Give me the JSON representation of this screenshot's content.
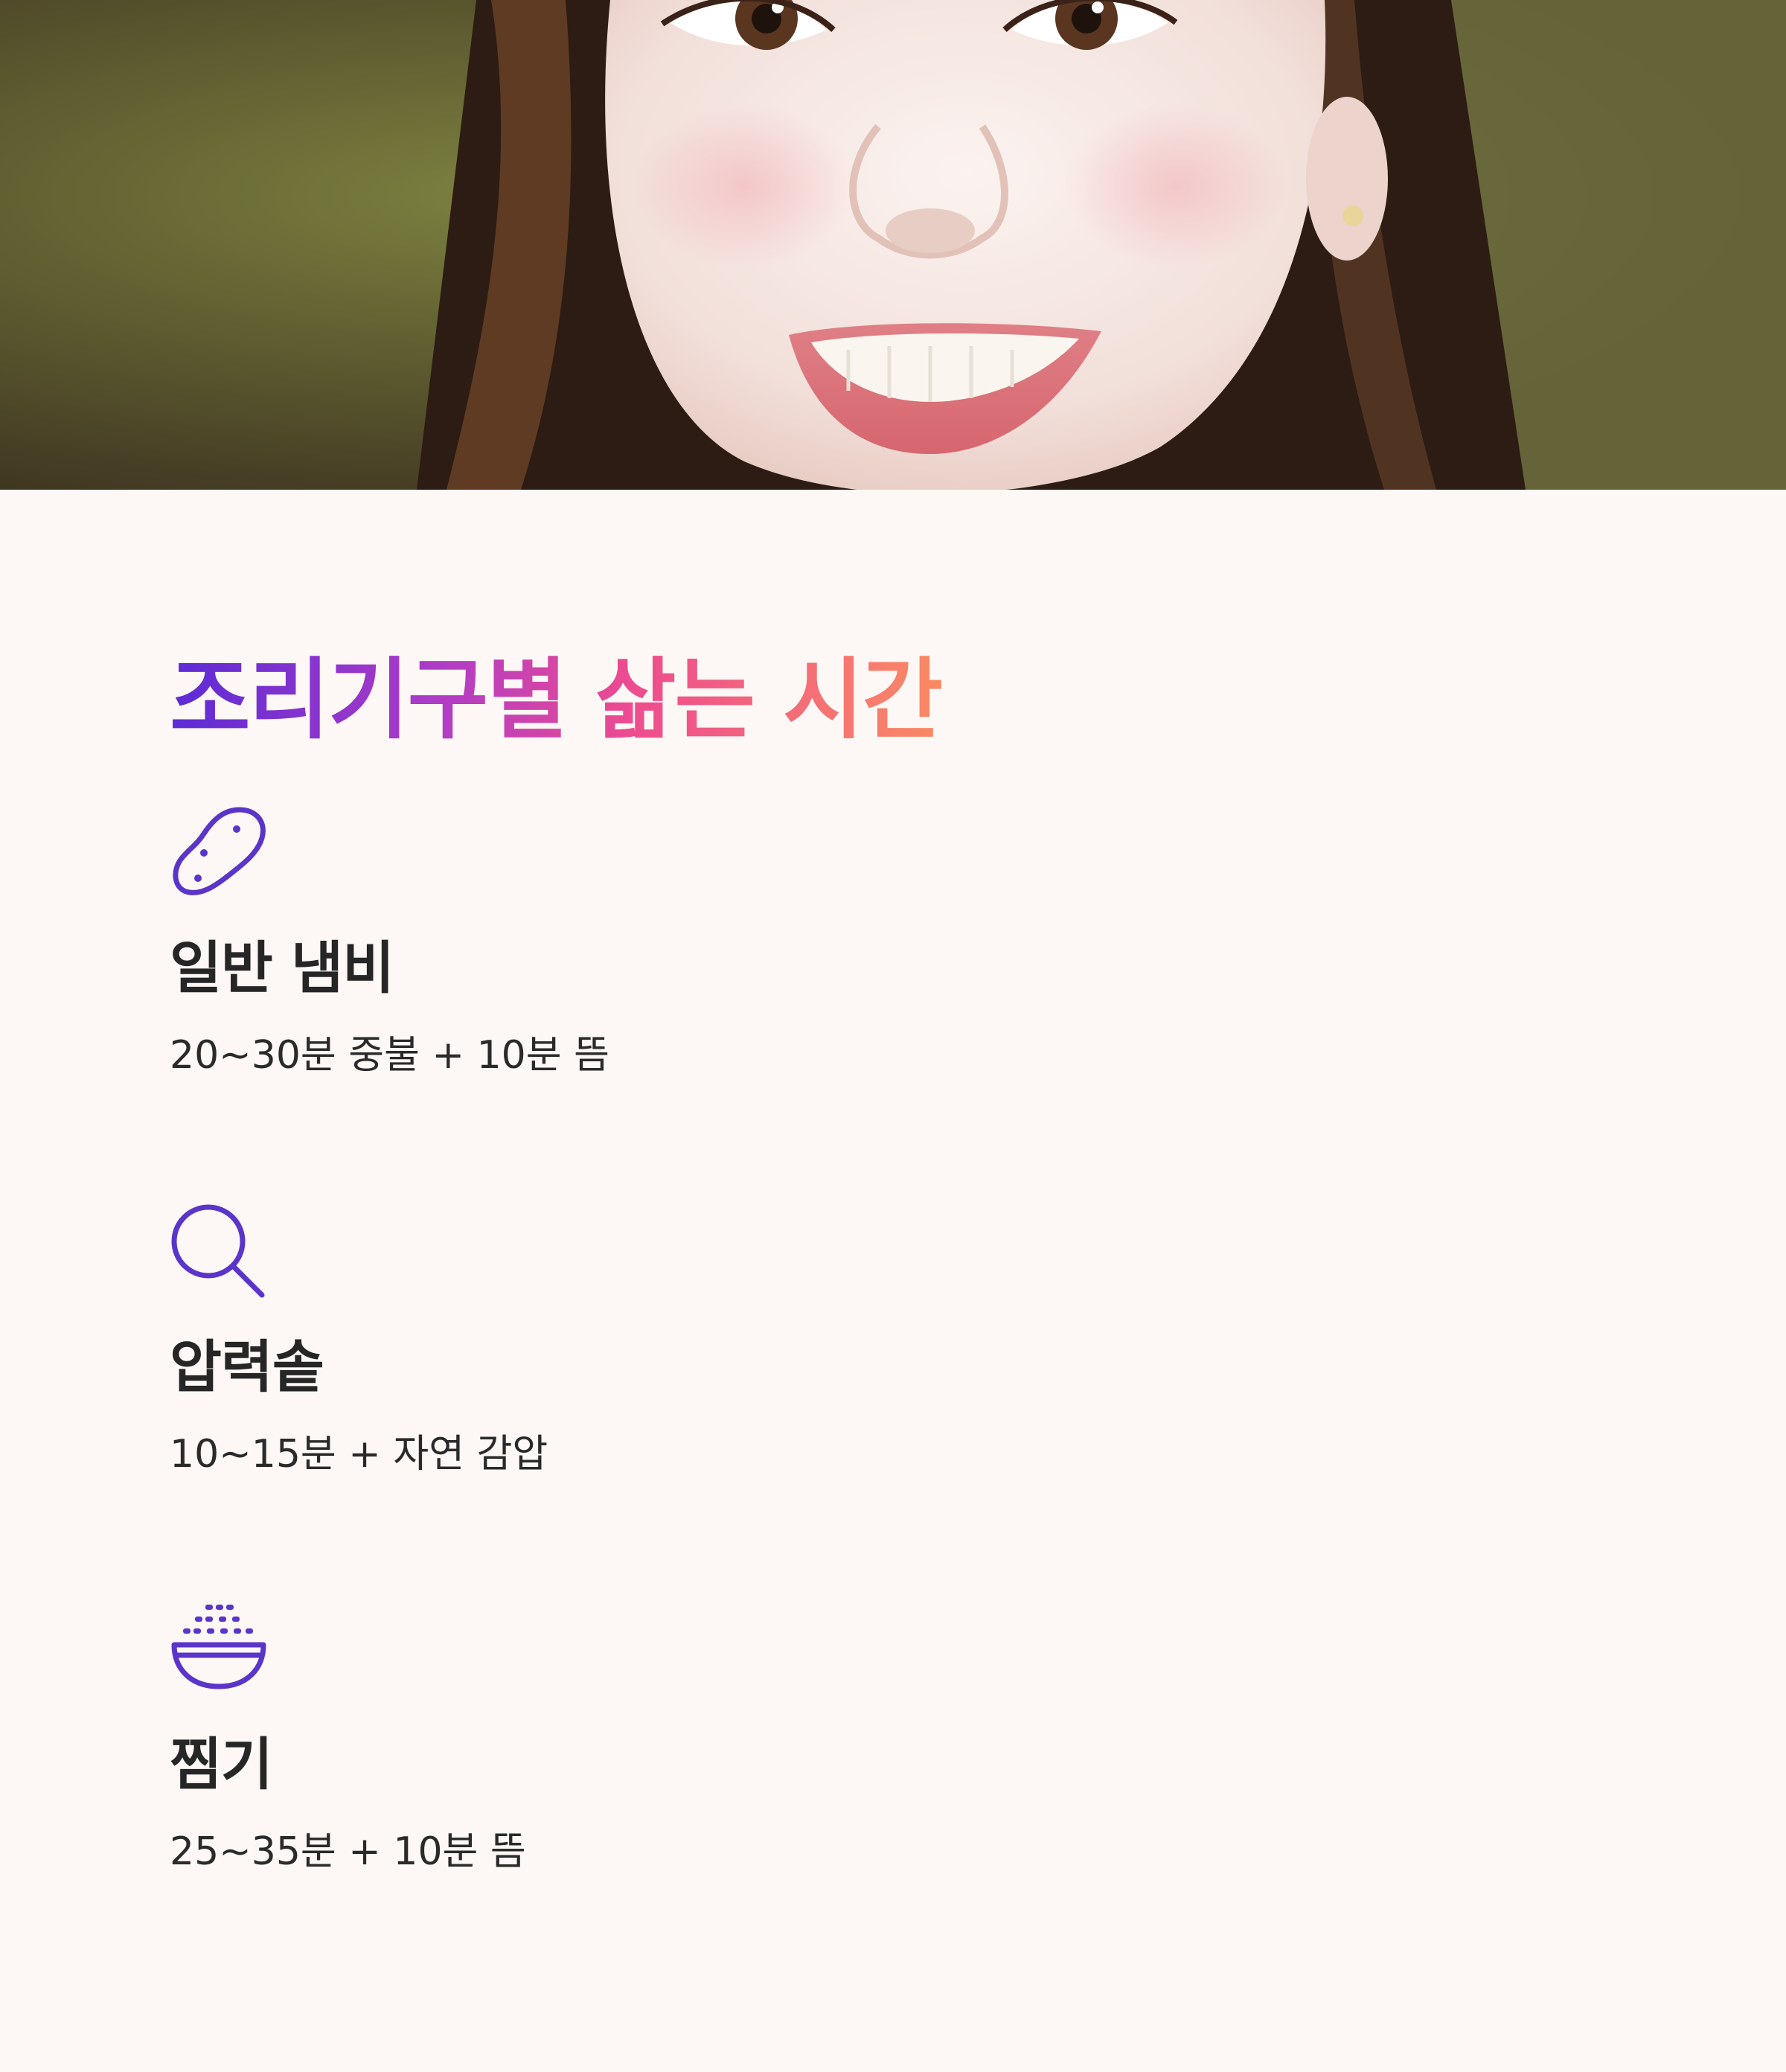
{
  "hero": {
    "image_alt": "smiling woman close-up portrait"
  },
  "section": {
    "title": "조리기구별 삶는 시간"
  },
  "methods": [
    {
      "icon": "potato-icon",
      "name": "일반 냄비",
      "time": "20~30분 중불 + 10분 뜸"
    },
    {
      "icon": "magnifier-icon",
      "name": "압력솥",
      "time": "10~15분 + 자연 감압"
    },
    {
      "icon": "steaming-bowl-icon",
      "name": "찜기",
      "time": "25~35분 + 10분 뜸"
    }
  ],
  "colors": {
    "background": "#fdf8f5",
    "icon": "#5b35c9",
    "title_gradient_start": "#5b2bd6",
    "title_gradient_end": "#f98a63",
    "text": "#262626"
  }
}
